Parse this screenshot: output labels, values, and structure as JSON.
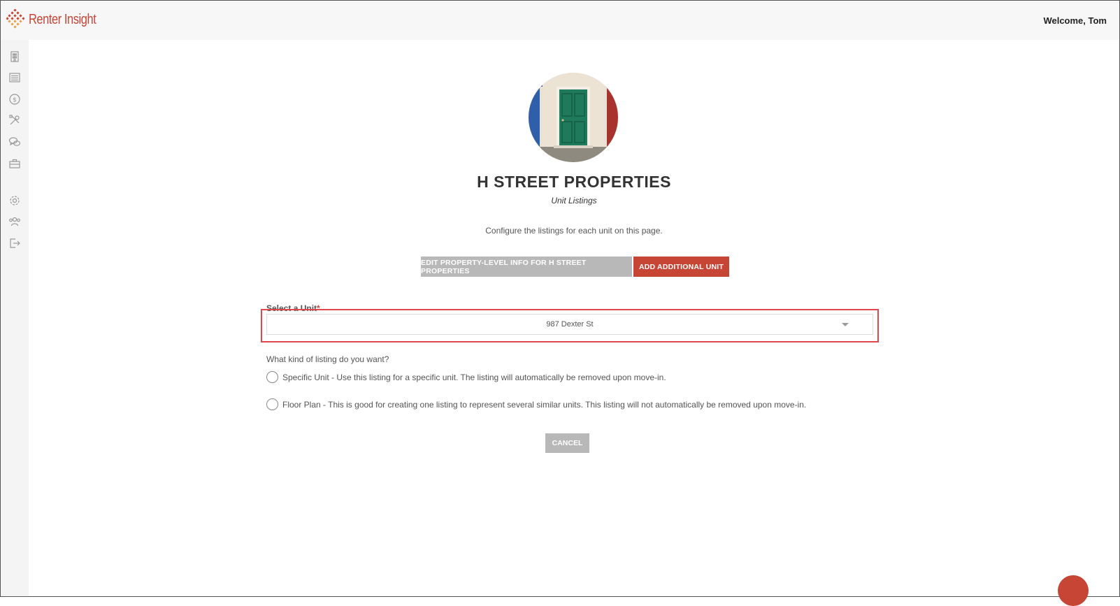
{
  "app": {
    "brand": "Renter Insight",
    "welcome": "Welcome, Tom"
  },
  "colors": {
    "accent": "#c74535",
    "button_gray": "#b8b8b8",
    "highlight": "#e0474c"
  },
  "sidebar": {
    "icons": [
      "building-icon",
      "list-icon",
      "dollar-icon",
      "tools-icon",
      "chat-icon",
      "briefcase-icon",
      "gear-icon",
      "users-icon",
      "logout-icon"
    ]
  },
  "page": {
    "title": "H STREET PROPERTIES",
    "subtitle": "Unit Listings",
    "description": "Configure the listings for each unit on this page.",
    "edit_button": "EDIT PROPERTY-LEVEL INFO FOR H STREET PROPERTIES",
    "add_button": "ADD ADDITIONAL UNIT",
    "select_label": "Select a Unit",
    "select_required": "*",
    "select_value": "987 Dexter St",
    "question": "What kind of listing do you want?",
    "options": [
      "Specific Unit - Use this listing for a specific unit. The listing will automatically be removed upon move-in.",
      "Floor Plan - This is good for creating one listing to represent several similar units. This listing will not automatically be removed upon move-in."
    ],
    "cancel_button": "CANCEL"
  }
}
